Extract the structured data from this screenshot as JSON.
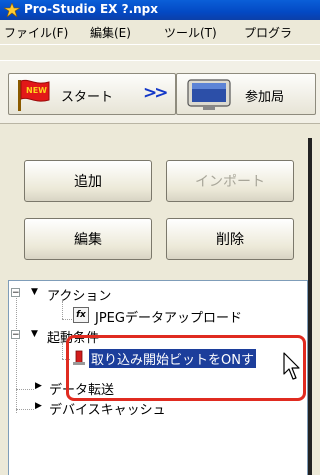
{
  "window": {
    "title": "Pro-Studio EX  ?.npx"
  },
  "menu": [
    {
      "label": "ファイル(F)"
    },
    {
      "label": "編集(E)"
    },
    {
      "label": "ツール(T)"
    },
    {
      "label": "プログラ"
    }
  ],
  "toolbar": {
    "start_badge": "NEW",
    "start_label": "スタート",
    "next_icon": ">>",
    "ref_label": "参加局"
  },
  "buttons": {
    "add": "追加",
    "import": "インポート",
    "edit": "編集",
    "delete": "削除"
  },
  "tree": {
    "expander_minus": "−",
    "action_group": "アクション",
    "action_item_icon": "fx",
    "action_item": "JPEGデータアップロード",
    "trigger_group": "起動条件",
    "trigger_item": "取り込み開始ビットをONす",
    "transfer_group": "データ転送",
    "cache_group": "デバイスキャッシュ"
  },
  "colors": {
    "titlebar": "#0349c4",
    "selection": "#1c3e9b",
    "highlight": "#e02b20"
  }
}
